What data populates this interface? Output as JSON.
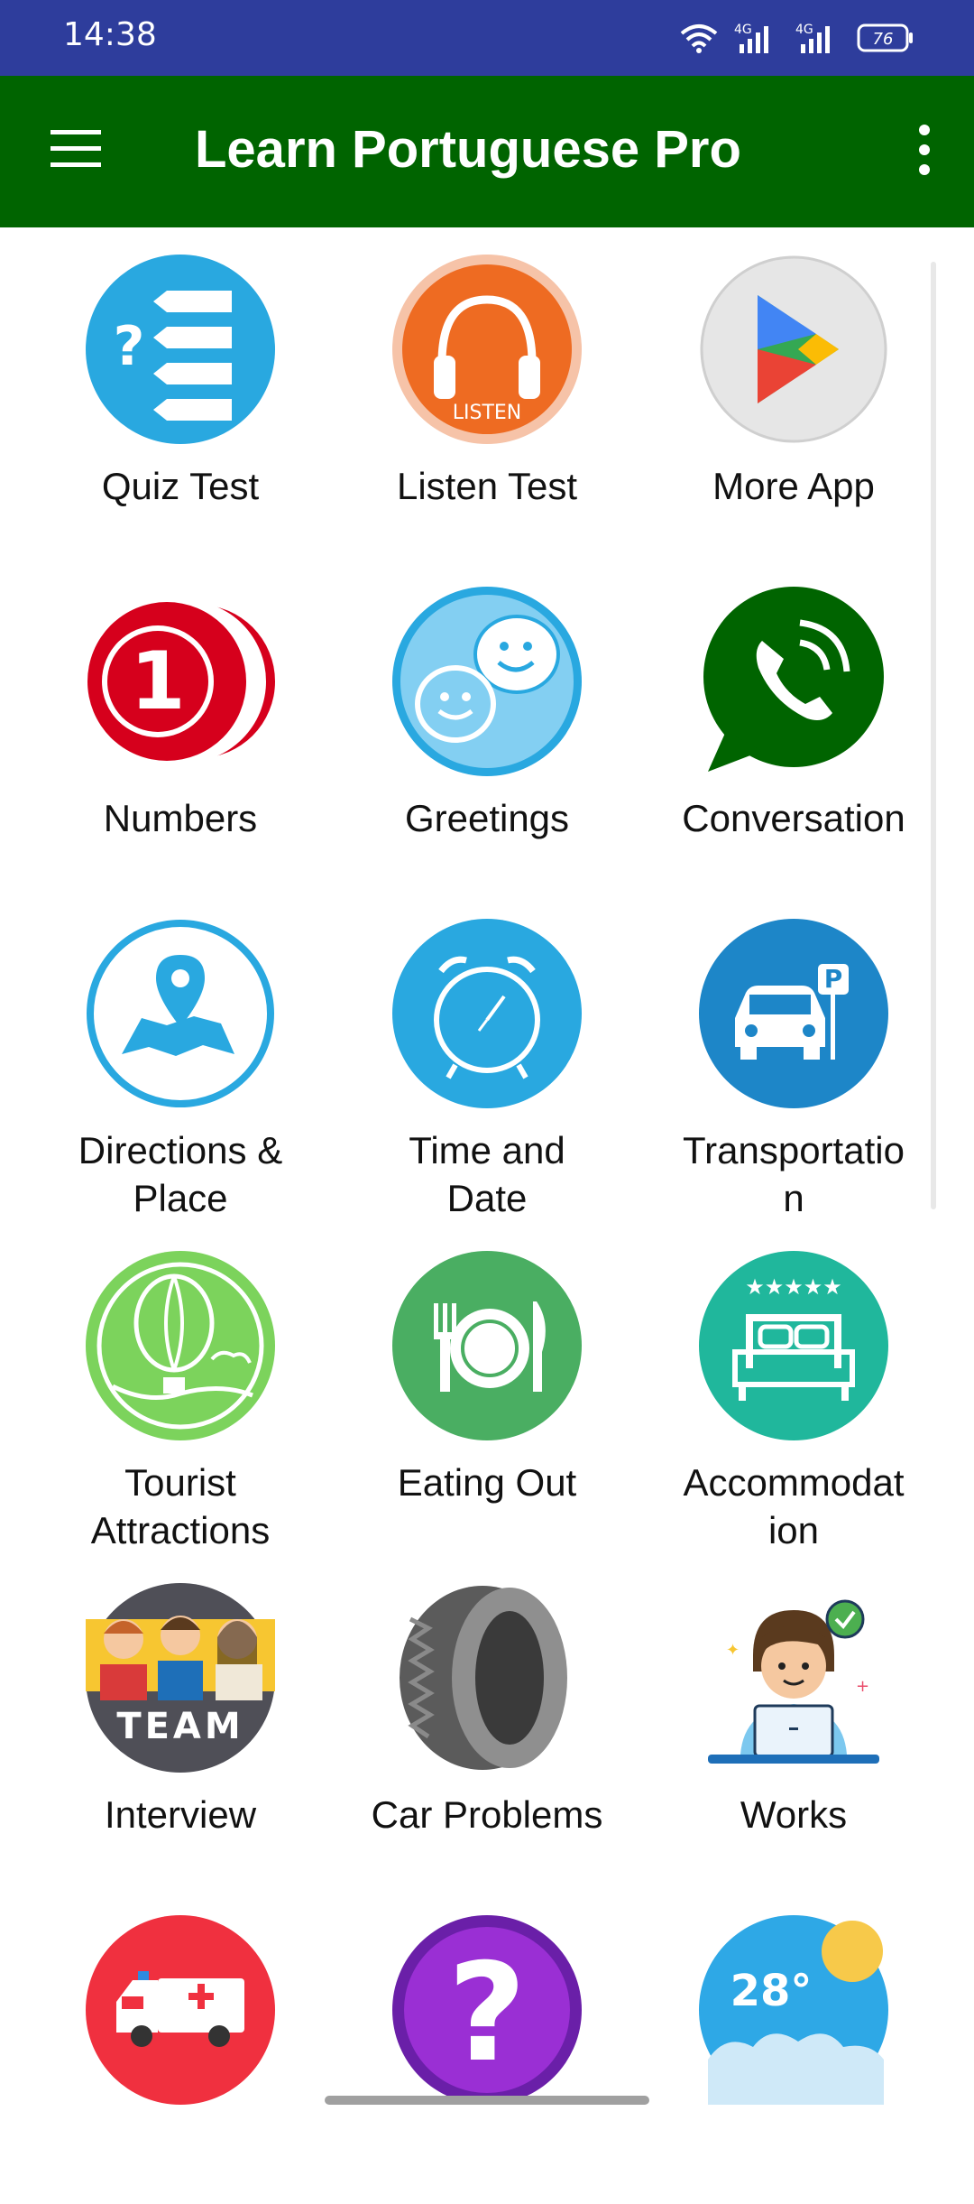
{
  "status_bar": {
    "time": "14:38",
    "network_1": "4G",
    "network_2": "4G",
    "battery": "76"
  },
  "app_bar": {
    "title": "Learn Portuguese Pro",
    "menu_icon": "hamburger-menu-icon",
    "overflow_icon": "more-vert-icon"
  },
  "tiles": [
    {
      "label": "Quiz Test",
      "icon": "quiz-icon"
    },
    {
      "label": "Listen Test",
      "icon": "headphones-icon",
      "icon_text": "LISTEN"
    },
    {
      "label": "More App",
      "icon": "play-store-icon"
    },
    {
      "label": "Numbers",
      "icon": "number-one-icon",
      "icon_text": "1"
    },
    {
      "label": "Greetings",
      "icon": "smiley-chat-icon"
    },
    {
      "label": "Conversation",
      "icon": "phone-chat-icon"
    },
    {
      "label": "Directions &\nPlace",
      "icon": "map-pin-icon"
    },
    {
      "label": "Time and\nDate",
      "icon": "alarm-clock-icon"
    },
    {
      "label": "Transportatio\nn",
      "icon": "car-parking-icon",
      "icon_text": "P"
    },
    {
      "label": "Tourist\nAttractions",
      "icon": "hot-air-balloon-icon"
    },
    {
      "label": "Eating Out",
      "icon": "fork-plate-knife-icon"
    },
    {
      "label": "Accommodat\nion",
      "icon": "hotel-bed-icon",
      "icon_text": "★★★★★"
    },
    {
      "label": "Interview",
      "icon": "team-icon",
      "icon_text": "TEAM"
    },
    {
      "label": "Car Problems",
      "icon": "tire-icon"
    },
    {
      "label": "Works",
      "icon": "person-laptop-icon"
    },
    {
      "label": "",
      "icon": "ambulance-icon"
    },
    {
      "label": "",
      "icon": "question-mark-icon",
      "icon_text": "?"
    },
    {
      "label": "",
      "icon": "weather-icon",
      "icon_text": "28°"
    }
  ],
  "colors": {
    "status_bar": "#2e3d9c",
    "app_bar": "#006400"
  }
}
